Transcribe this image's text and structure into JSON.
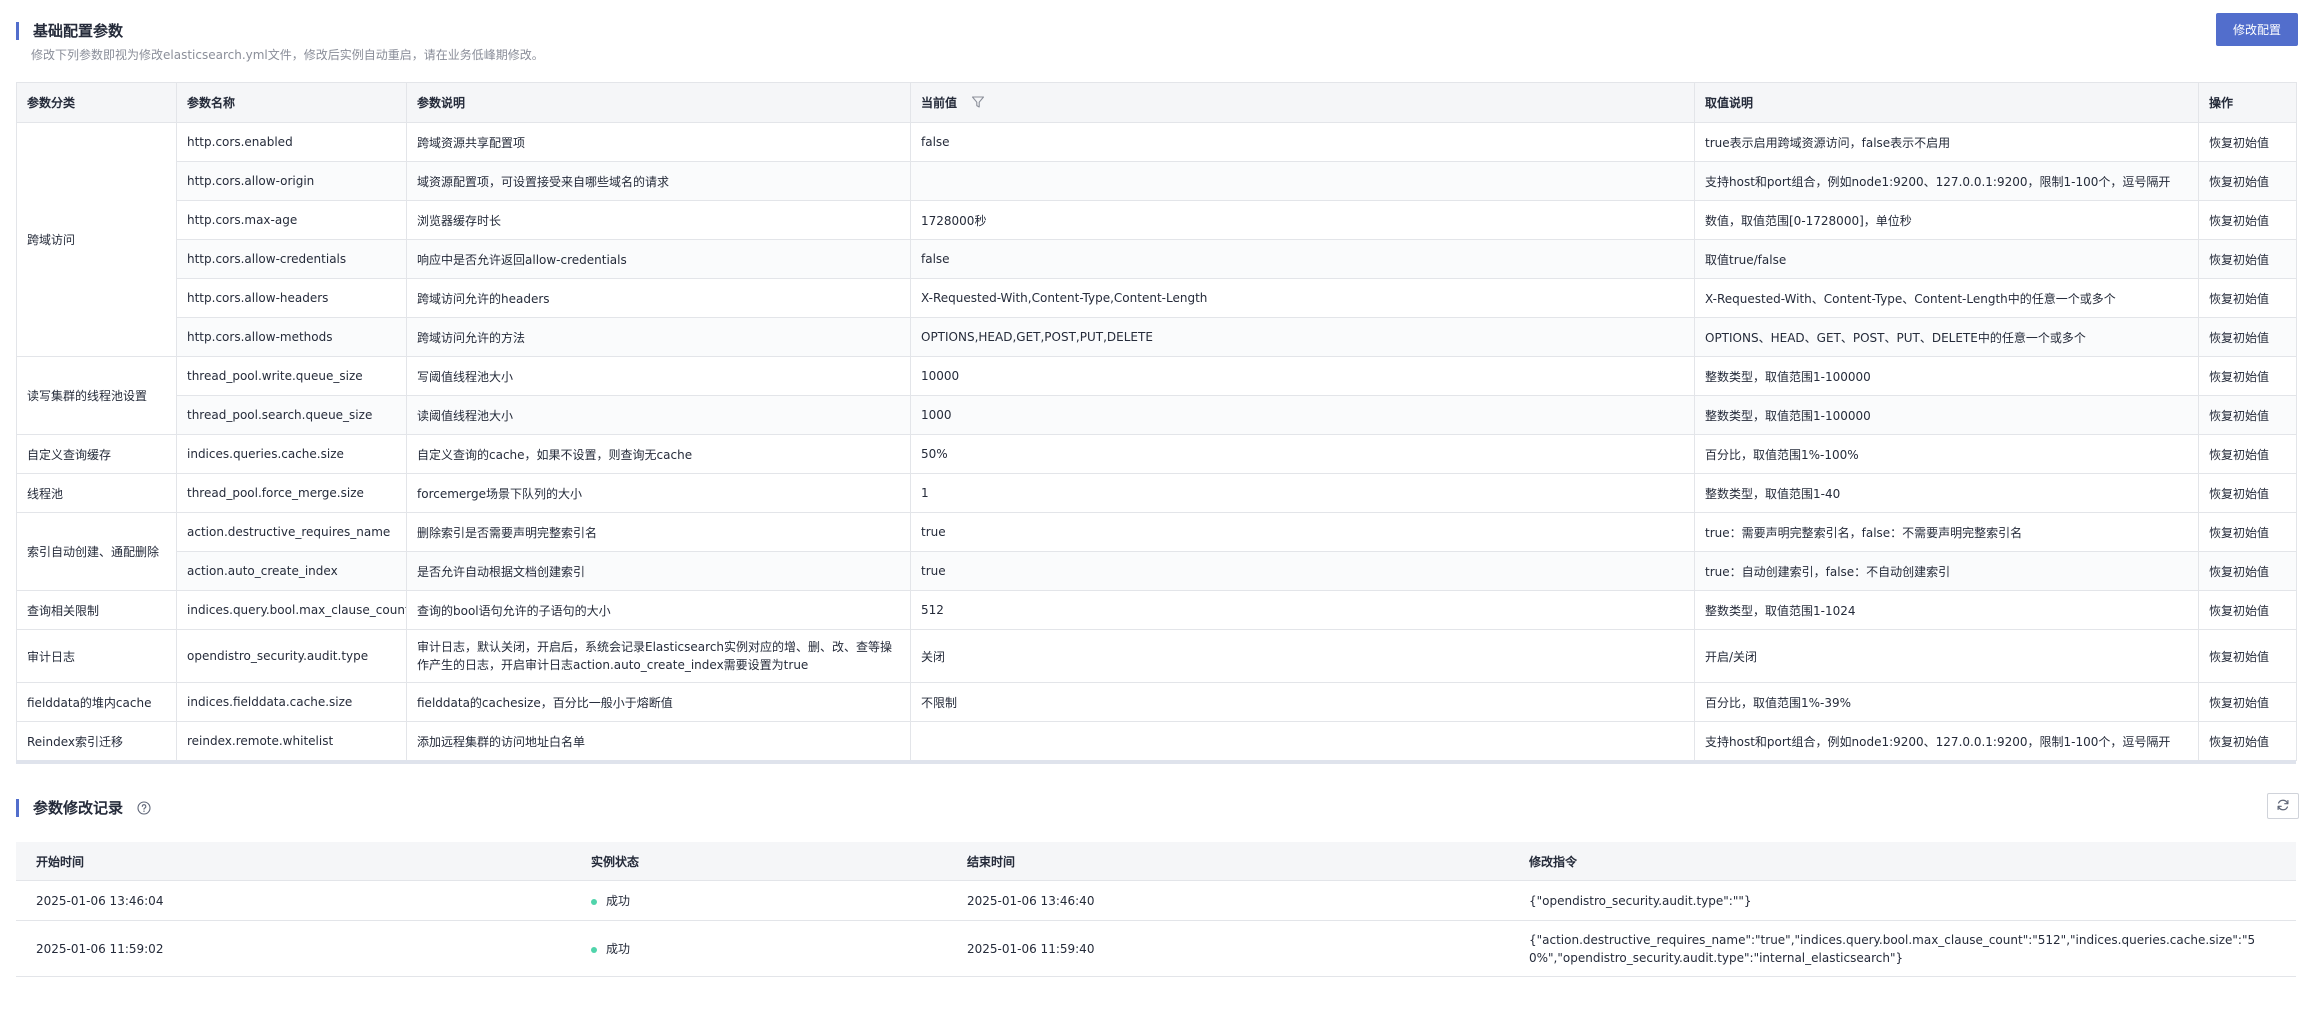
{
  "basic_config": {
    "title": "基础配置参数",
    "description": "修改下列参数即视为修改elasticsearch.yml文件，修改后实例自动重启，请在业务低峰期修改。",
    "modify_button": "修改配置",
    "columns": [
      "参数分类",
      "参数名称",
      "参数说明",
      "当前值",
      "取值说明",
      "操作"
    ],
    "categories": [
      "跨域访问",
      "读写集群的线程池设置",
      "自定义查询缓存",
      "线程池",
      "索引自动创建、通配删除",
      "查询相关限制",
      "审计日志",
      "fielddata的堆内cache",
      "Reindex索引迁移"
    ],
    "action_label": "恢复初始值",
    "rows": [
      {
        "name": "http.cors.enabled",
        "desc": "跨域资源共享配置项",
        "value": "false",
        "range": "true表示启用跨域资源访问，false表示不启用"
      },
      {
        "name": "http.cors.allow-origin",
        "desc": "域资源配置项，可设置接受来自哪些域名的请求",
        "value": "",
        "range": "支持host和port组合，例如node1:9200、127.0.0.1:9200，限制1-100个，逗号隔开"
      },
      {
        "name": "http.cors.max-age",
        "desc": "浏览器缓存时长",
        "value": "1728000秒",
        "range": "数值，取值范围[0-1728000]，单位秒"
      },
      {
        "name": "http.cors.allow-credentials",
        "desc": "响应中是否允许返回allow-credentials",
        "value": "false",
        "range": "取值true/false"
      },
      {
        "name": "http.cors.allow-headers",
        "desc": "跨域访问允许的headers",
        "value": "X-Requested-With,Content-Type,Content-Length",
        "range": "X-Requested-With、Content-Type、Content-Length中的任意一个或多个"
      },
      {
        "name": "http.cors.allow-methods",
        "desc": "跨域访问允许的方法",
        "value": "OPTIONS,HEAD,GET,POST,PUT,DELETE",
        "range": "OPTIONS、HEAD、GET、POST、PUT、DELETE中的任意一个或多个"
      },
      {
        "name": "thread_pool.write.queue_size",
        "desc": "写阈值线程池大小",
        "value": "10000",
        "range": "整数类型，取值范围1-100000"
      },
      {
        "name": "thread_pool.search.queue_size",
        "desc": "读阈值线程池大小",
        "value": "1000",
        "range": "整数类型，取值范围1-100000"
      },
      {
        "name": "indices.queries.cache.size",
        "desc": "自定义查询的cache，如果不设置，则查询无cache",
        "value": "50%",
        "range": "百分比，取值范围1%-100%"
      },
      {
        "name": "thread_pool.force_merge.size",
        "desc": "forcemerge场景下队列的大小",
        "value": "1",
        "range": "整数类型，取值范围1-40"
      },
      {
        "name": "action.destructive_requires_name",
        "desc": "删除索引是否需要声明完整索引名",
        "value": "true",
        "range": "true：需要声明完整索引名，false：不需要声明完整索引名"
      },
      {
        "name": "action.auto_create_index",
        "desc": "是否允许自动根据文档创建索引",
        "value": "true",
        "range": "true：自动创建索引，false：不自动创建索引"
      },
      {
        "name": "indices.query.bool.max_clause_count",
        "desc": "查询的bool语句允许的子语句的大小",
        "value": "512",
        "range": "整数类型，取值范围1-1024"
      },
      {
        "name": "opendistro_security.audit.type",
        "desc": "审计日志，默认关闭，开启后，系统会记录Elasticsearch实例对应的增、删、改、查等操作产生的日志，开启审计日志action.auto_create_index需要设置为true",
        "value": "关闭",
        "range": "开启/关闭"
      },
      {
        "name": "indices.fielddata.cache.size",
        "desc": "fielddata的cachesize，百分比一般小于熔断值",
        "value": "不限制",
        "range": "百分比，取值范围1%-39%"
      },
      {
        "name": "reindex.remote.whitelist",
        "desc": "添加远程集群的访问地址白名单",
        "value": "",
        "range": "支持host和port组合，例如node1:9200、127.0.0.1:9200，限制1-100个，逗号隔开"
      }
    ]
  },
  "history": {
    "title": "参数修改记录",
    "columns": [
      "开始时间",
      "实例状态",
      "结束时间",
      "修改指令"
    ],
    "rows": [
      {
        "start": "2025-01-06 13:46:04",
        "status": "成功",
        "end": "2025-01-06 13:46:40",
        "command": "{\"opendistro_security.audit.type\":\"\"}"
      },
      {
        "start": "2025-01-06 11:59:02",
        "status": "成功",
        "end": "2025-01-06 11:59:40",
        "command": "{\"action.destructive_requires_name\":\"true\",\"indices.query.bool.max_clause_count\":\"512\",\"indices.queries.cache.size\":\"50%\",\"opendistro_security.audit.type\":\"internal_elasticsearch\"}"
      }
    ]
  },
  "colors": {
    "accent": "#526ecc",
    "success": "#50d4ab",
    "link_disabled": "#b8c6ee"
  }
}
